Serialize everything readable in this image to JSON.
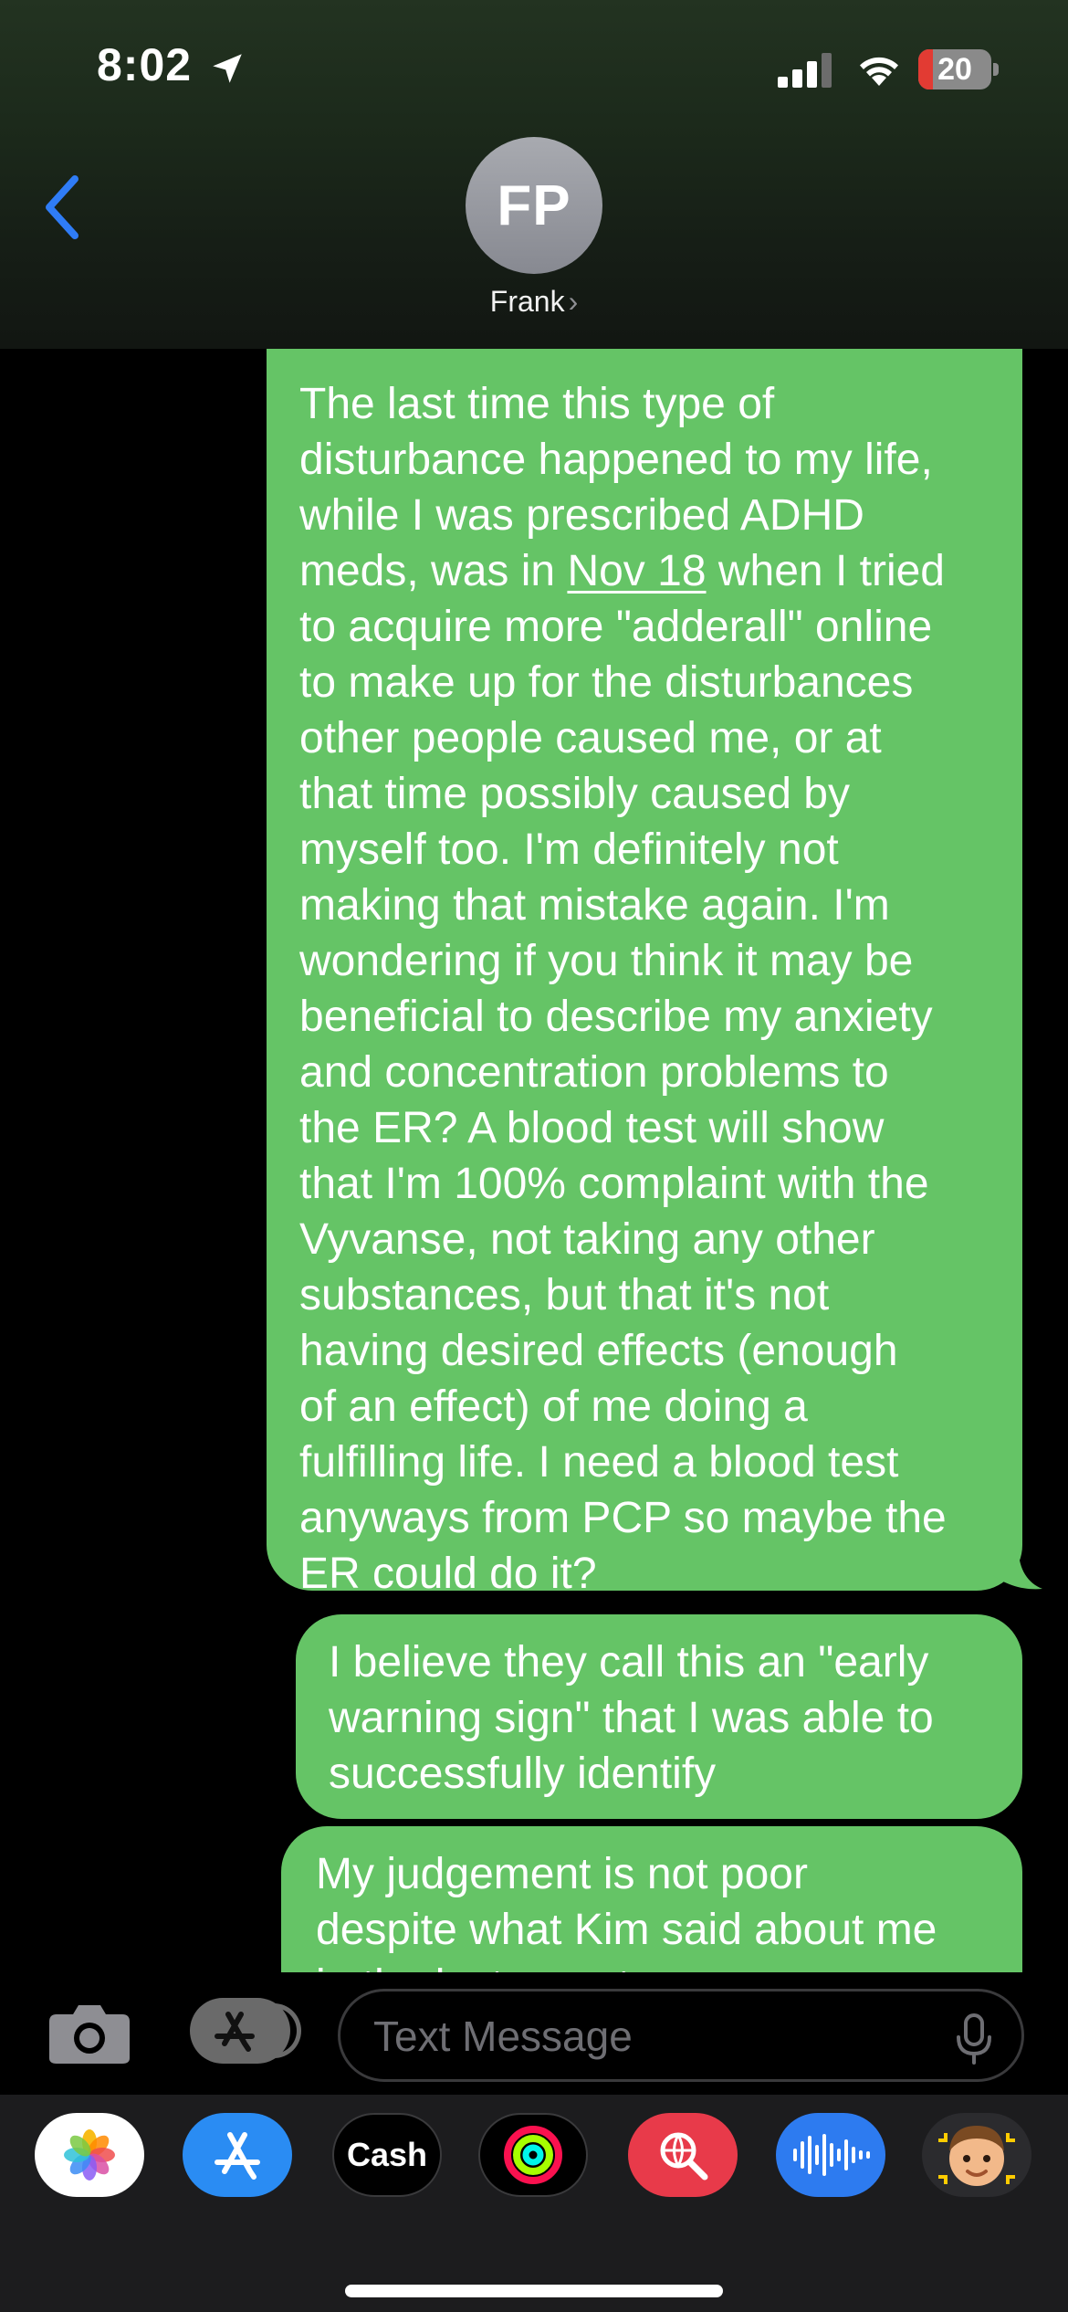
{
  "status_bar": {
    "time": "8:02",
    "battery_level": "20",
    "battery_fraction": 0.2,
    "icons": [
      "location-arrow-icon",
      "cellular-signal-icon",
      "wifi-icon",
      "battery-icon"
    ]
  },
  "conversation": {
    "contact_initials": "FP",
    "contact_name": "Frank",
    "contact_chevron": "›"
  },
  "messages": [
    {
      "sender": "me",
      "lines": [
        "The last time this type of",
        "disturbance happened to my life,",
        "while I was prescribed ADHD",
        "meds, was in ",
        "to acquire more \"adderall\" online",
        "to make up for the disturbances",
        "other people caused me, or at",
        "that time possibly caused by",
        "myself too. I'm definitely not",
        "making that mistake again. I'm",
        "wondering if you think it may be",
        "beneficial to describe my anxiety",
        "and concentration problems to",
        "the ER? A blood test will show",
        "that I'm 100% complaint with the",
        "Vyvanse, not taking any other",
        "substances, but that it's not",
        "having desired effects (enough",
        "of an effect) of me doing a",
        "fulfilling life. I need a blood test",
        "anyways from PCP so maybe the",
        "ER could do it?"
      ],
      "date_link": "Nov 18",
      "line4_suffix": " when I tried"
    },
    {
      "sender": "me",
      "lines": [
        "I believe they call this an \"early",
        "warning sign\" that I was able to",
        "successfully identify"
      ]
    },
    {
      "sender": "me",
      "lines": [
        "My judgement is not poor",
        "despite what Kim said about me",
        "in the last report"
      ]
    }
  ],
  "composer": {
    "placeholder": "Text Message",
    "camera_icon": "camera-icon",
    "apps_icon": "app-store-icon",
    "mic_icon": "microphone-icon"
  },
  "app_drawer": {
    "apps": [
      "Photos",
      "App Store",
      "Cash",
      "Fitness",
      "Search",
      "Audio Message",
      "Memoji"
    ],
    "cash_label": "Cash",
    "cash_symbol": ""
  },
  "colors": {
    "bubble_green": "#65c466",
    "accent_blue": "#2f7cf6",
    "background": "#000000"
  }
}
